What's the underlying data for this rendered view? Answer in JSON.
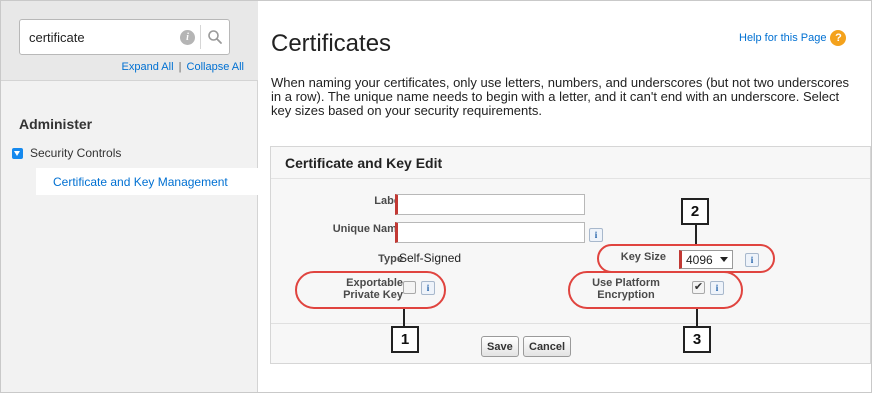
{
  "sidebar": {
    "search": {
      "value": "certificate"
    },
    "expand_all": "Expand All",
    "separator": "|",
    "collapse_all": "Collapse All",
    "section_heading": "Administer",
    "group_label": "Security Controls",
    "selected_item": "Certificate and Key Management"
  },
  "header": {
    "title": "Certificates",
    "help_link": "Help for this Page"
  },
  "description": "When naming your certificates, only use letters, numbers, and underscores (but not two underscores in a row). The unique name needs to begin with a letter, and it can't end with an underscore. Select key sizes based on your security requirements.",
  "form": {
    "title": "Certificate and Key Edit",
    "label_field": {
      "label": "Label",
      "value": ""
    },
    "unique_name_field": {
      "label": "Unique Name",
      "value": ""
    },
    "type_field": {
      "label": "Type",
      "value": "Self-Signed"
    },
    "key_size_field": {
      "label": "Key Size",
      "value": "4096"
    },
    "exportable_field": {
      "label_line1": "Exportable",
      "label_line2": "Private Key",
      "checked": false
    },
    "platform_encryption_field": {
      "label_line1": "Use Platform",
      "label_line2": "Encryption",
      "checked": true,
      "check_glyph": "✔"
    },
    "info_glyph": "i",
    "save_label": "Save",
    "cancel_label": "Cancel"
  },
  "callouts": [
    "1",
    "2",
    "3"
  ],
  "icons": {
    "search_info": "info-icon",
    "search": "search-icon",
    "help": "help-icon",
    "help_glyph": "?",
    "search_info_glyph": "i"
  },
  "colors": {
    "link": "#0070d2",
    "required_marker": "#c23934",
    "callout_outline": "#e0443f",
    "help_badge": "#f4a21c"
  }
}
